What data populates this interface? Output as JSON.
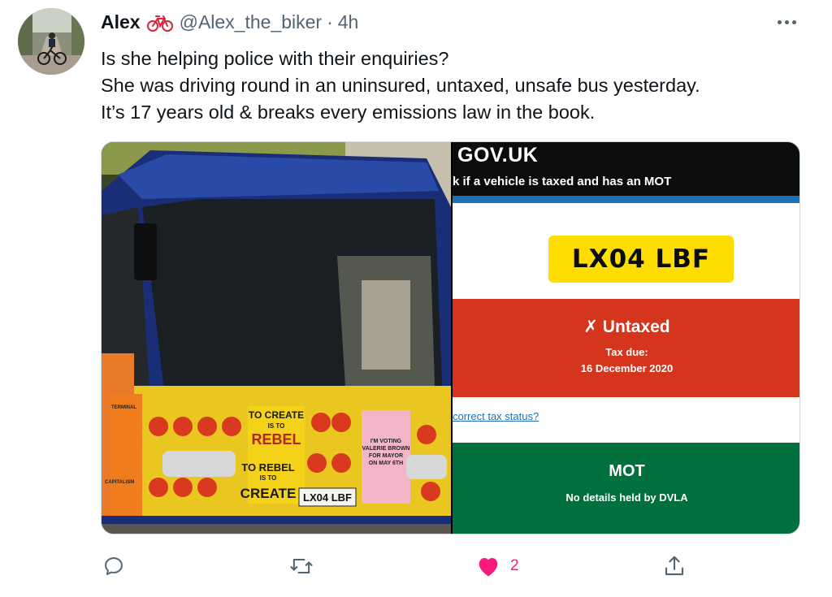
{
  "tweet": {
    "author_name": "Alex",
    "author_emoji_icon": "bicycle-icon",
    "handle": "@Alex_the_biker",
    "separator": "·",
    "time": "4h",
    "lines": [
      "Is she helping police with their enquiries?",
      "She was driving round in an uninsured, untaxed, unsafe bus yesterday.",
      "It’s 17 years old & breaks every emissions law in the book."
    ]
  },
  "gov_screenshot": {
    "logo": "GOV.UK",
    "subtitle": "k if a vehicle is taxed and has an MOT",
    "plate": "LX04 LBF",
    "tax_status": "✗ Untaxed",
    "tax_due_label": "Tax due:",
    "tax_due_date": "16 December 2020",
    "tax_link": "correct tax status?",
    "mot_title": "MOT",
    "mot_detail": "No details held by DVLA"
  },
  "bus_photo": {
    "plate": "LX04 LBF",
    "poster_lines": [
      "TO CREATE",
      "IS TO",
      "REBEL",
      "TO REBEL",
      "IS TO",
      "CREATE"
    ],
    "pink_poster": [
      "I'M VOTING",
      "VALERIE BROWN",
      "FOR MAYOR",
      "ON MAY 6TH"
    ],
    "side_posters": [
      "TERMINAL",
      "CAPITALISM"
    ]
  },
  "actions": {
    "like_count": "2"
  },
  "colors": {
    "gov_red": "#d4351c",
    "gov_green": "#00703c",
    "gov_blue": "#1d70b8",
    "like_pink": "#f91880",
    "plate_yellow": "#ffdd00"
  }
}
